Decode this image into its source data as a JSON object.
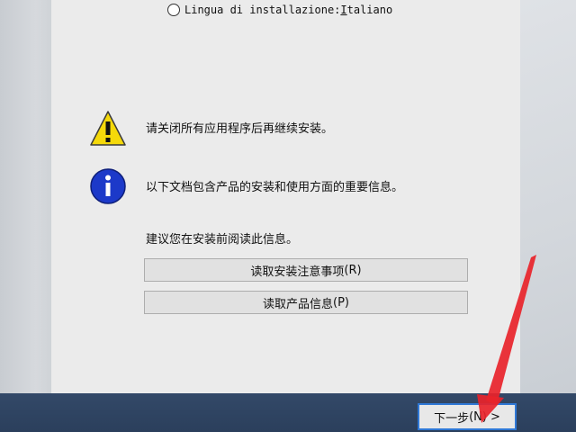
{
  "language_option": {
    "prefix": "Lingua di installazione: ",
    "underlined_letter": "I",
    "rest": "taliano"
  },
  "messages": {
    "warning": "请关闭所有应用程序后再继续安装。",
    "info": "以下文档包含产品的安装和使用方面的重要信息。",
    "recommend": "建议您在安装前阅读此信息。"
  },
  "buttons": {
    "read_notes": {
      "label": "读取安装注意事项",
      "accel": "(R)"
    },
    "read_product_info": {
      "label": "读取产品信息",
      "accel": "(P)"
    },
    "next": {
      "label": "下一步",
      "accel": "(N)",
      "arrow": ">"
    }
  },
  "icons": {
    "warning": "warning-icon",
    "info": "info-icon"
  },
  "colors": {
    "warning_yellow": "#f5d90a",
    "info_blue": "#1c39c9",
    "annotation_red": "#e8232a",
    "taskbar": "#2f4463",
    "focus_border": "#2f78d6"
  }
}
